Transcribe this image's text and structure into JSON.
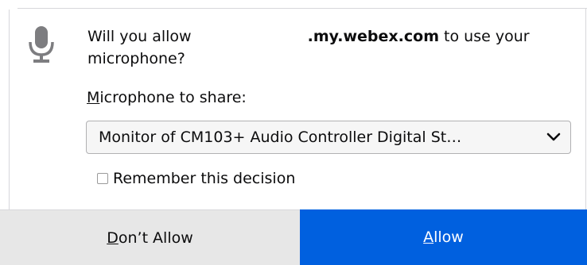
{
  "prompt": {
    "question_before": "Will you allow ",
    "host": ".my.webex.com",
    "question_after": " to use your microphone?",
    "icon": "microphone-icon"
  },
  "device": {
    "label_accesskey": "M",
    "label_rest": "icrophone to share:",
    "selected": "Monitor of CM103+ Audio Controller Digital St…"
  },
  "remember": {
    "label": "Remember this decision",
    "checked": false
  },
  "actions": {
    "deny_accesskey": "D",
    "deny_rest": "on’t Allow",
    "allow_accesskey": "A",
    "allow_rest": "llow"
  },
  "colors": {
    "allow_button": "#0060df",
    "deny_button": "#e7e7e7"
  }
}
